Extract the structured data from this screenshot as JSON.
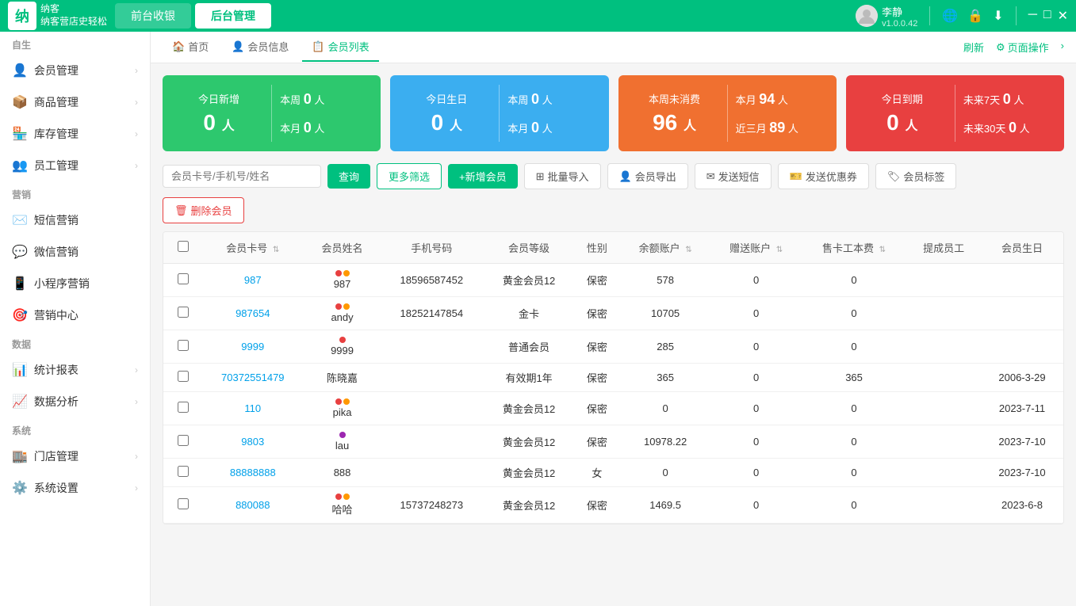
{
  "header": {
    "logo_char": "纳",
    "logo_subtitle": "纳客营店史轻松",
    "tab_front": "前台收银",
    "tab_back": "后台管理",
    "user_name": "李静",
    "user_version": "v1.0.0.42"
  },
  "sidebar": {
    "section_self": "自生",
    "items_main": [
      {
        "label": "会员管理",
        "icon": "👤"
      },
      {
        "label": "商品管理",
        "icon": "📦"
      },
      {
        "label": "库存管理",
        "icon": "🏪"
      },
      {
        "label": "员工管理",
        "icon": "👥"
      }
    ],
    "section_marketing": "营销",
    "items_marketing": [
      {
        "label": "短信营销",
        "icon": "✉️"
      },
      {
        "label": "微信营销",
        "icon": "💬"
      },
      {
        "label": "小程序营销",
        "icon": "📱"
      },
      {
        "label": "营销中心",
        "icon": "🎯"
      }
    ],
    "section_data": "数据",
    "items_data": [
      {
        "label": "统计报表",
        "icon": "📊"
      },
      {
        "label": "数据分析",
        "icon": "📈"
      }
    ],
    "section_system": "系统",
    "items_system": [
      {
        "label": "门店管理",
        "icon": "🏬"
      },
      {
        "label": "系统设置",
        "icon": "⚙️"
      }
    ]
  },
  "page_tabs": {
    "home": "首页",
    "member_info": "会员信息",
    "member_list": "会员列表",
    "refresh": "刷新",
    "page_op": "页面操作"
  },
  "stats": {
    "today_new": {
      "title": "今日新增",
      "value": "0 人",
      "week_label": "本周",
      "week_value": "0",
      "week_unit": "人",
      "month_label": "本月",
      "month_value": "0",
      "month_unit": "人"
    },
    "today_birthday": {
      "title": "今日生日",
      "value": "0 人",
      "week_label": "本周",
      "week_value": "0",
      "week_unit": "人",
      "month_label": "本月",
      "month_value": "0",
      "month_unit": "人"
    },
    "no_consume": {
      "title": "本周未消费",
      "value": "96 人",
      "month_label": "本月",
      "month_value": "94",
      "month_unit": "人",
      "recent3_label": "近三月",
      "recent3_value": "89",
      "recent3_unit": "人"
    },
    "expire_today": {
      "title": "今日到期",
      "value": "0 人",
      "next7_label": "未来7天",
      "next7_value": "0",
      "next7_unit": "人",
      "next30_label": "未来30天",
      "next30_value": "0",
      "next30_unit": "人"
    }
  },
  "toolbar": {
    "search_placeholder": "会员卡号/手机号/姓名",
    "btn_query": "查询",
    "btn_more_filter": "更多筛选",
    "btn_add_member": "+新增会员",
    "btn_batch_import": "批量导入",
    "btn_member_export": "会员导出",
    "btn_send_sms": "发送短信",
    "btn_send_coupon": "发送优惠券",
    "btn_member_tag": "会员标签",
    "btn_delete": "删除会员"
  },
  "table": {
    "headers": [
      "会员卡号",
      "会员姓名",
      "手机号码",
      "会员等级",
      "性别",
      "余额账户",
      "赠送账户",
      "售卡工本费",
      "提成员工",
      "会员生日"
    ],
    "rows": [
      {
        "id": "987",
        "name": "987",
        "dots": [
          "red",
          "orange"
        ],
        "phone": "18596587452",
        "level": "黄金会员12",
        "gender": "保密",
        "balance": "578",
        "gift": "0",
        "card_fee": "0",
        "staff": "",
        "birthday": ""
      },
      {
        "id": "987654",
        "name": "andy",
        "dots": [
          "red",
          "orange"
        ],
        "phone": "18252147854",
        "level": "金卡",
        "gender": "保密",
        "balance": "10705",
        "gift": "0",
        "card_fee": "0",
        "staff": "",
        "birthday": ""
      },
      {
        "id": "9999",
        "name": "9999",
        "dots": [
          "red"
        ],
        "phone": "",
        "level": "普通会员",
        "gender": "保密",
        "balance": "285",
        "gift": "0",
        "card_fee": "0",
        "staff": "",
        "birthday": ""
      },
      {
        "id": "70372551479",
        "name": "陈晓嘉",
        "dots": [],
        "phone": "",
        "level": "有效期1年",
        "gender": "保密",
        "balance": "365",
        "gift": "0",
        "card_fee": "365",
        "staff": "",
        "birthday": "2006-3-29"
      },
      {
        "id": "110",
        "name": "pika",
        "dots": [
          "red",
          "orange"
        ],
        "phone": "",
        "level": "黄金会员12",
        "gender": "保密",
        "balance": "0",
        "gift": "0",
        "card_fee": "0",
        "staff": "",
        "birthday": "2023-7-11"
      },
      {
        "id": "9803",
        "name": "lau",
        "dots": [
          "purple"
        ],
        "phone": "",
        "level": "黄金会员12",
        "gender": "保密",
        "balance": "10978.22",
        "gift": "0",
        "card_fee": "0",
        "staff": "",
        "birthday": "2023-7-10"
      },
      {
        "id": "88888888",
        "name": "888",
        "dots": [],
        "phone": "",
        "level": "黄金会员12",
        "gender": "女",
        "balance": "0",
        "gift": "0",
        "card_fee": "0",
        "staff": "",
        "birthday": "2023-7-10"
      },
      {
        "id": "880088",
        "name": "哈哈",
        "dots": [
          "red",
          "orange"
        ],
        "phone": "15737248273",
        "level": "黄金会员12",
        "gender": "保密",
        "balance": "1469.5",
        "gift": "0",
        "card_fee": "0",
        "staff": "",
        "birthday": "2023-6-8"
      }
    ]
  }
}
